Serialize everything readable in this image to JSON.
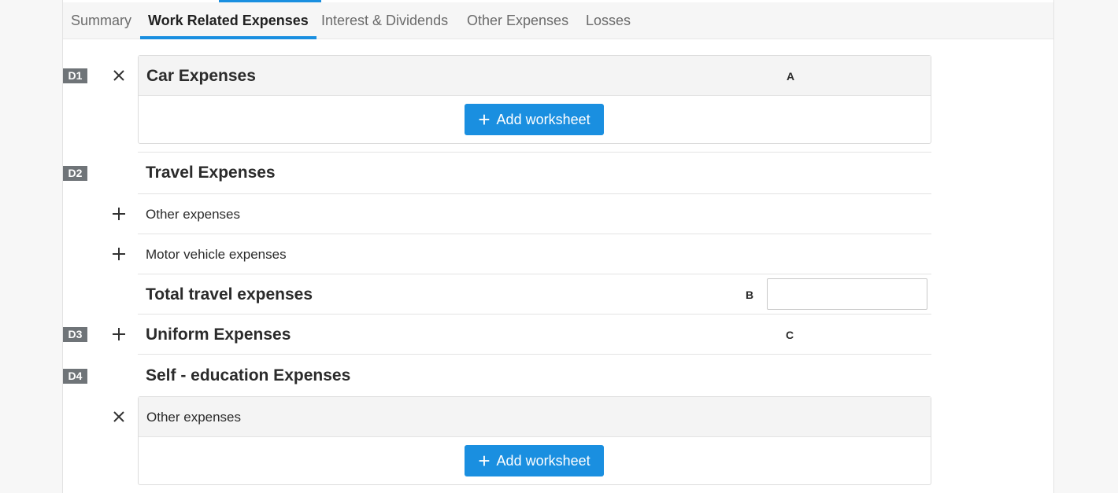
{
  "tabs": [
    {
      "label": "Summary"
    },
    {
      "label": "Work Related Expenses"
    },
    {
      "label": "Interest & Dividends"
    },
    {
      "label": "Other Expenses"
    },
    {
      "label": "Losses"
    }
  ],
  "sections": {
    "d1": {
      "badge": "D1",
      "title": "Car Expenses",
      "column": "A",
      "button": "Add worksheet"
    },
    "d2": {
      "badge": "D2",
      "title": "Travel Expenses",
      "items": [
        {
          "label": "Other expenses"
        },
        {
          "label": "Motor vehicle expenses"
        }
      ],
      "total_label": "Total travel expenses",
      "total_column": "B",
      "total_value": ""
    },
    "d3": {
      "badge": "D3",
      "title": "Uniform Expenses",
      "column": "C"
    },
    "d4": {
      "badge": "D4",
      "title": "Self - education Expenses",
      "sub_title": "Other expenses",
      "button": "Add worksheet"
    }
  },
  "colors": {
    "accent": "#1a8fe0",
    "badge": "#6f7478"
  }
}
